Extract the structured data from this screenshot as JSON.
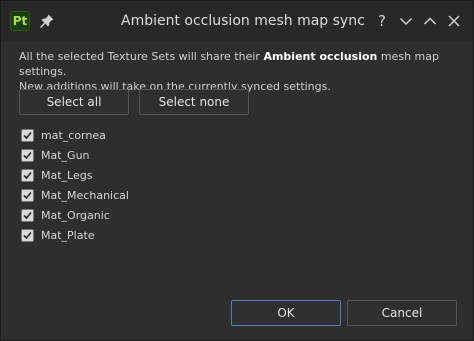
{
  "window": {
    "title": "Ambient occlusion mesh map sync",
    "logo_text": "Pt"
  },
  "titlebar_buttons": {
    "help": "?",
    "minimize": "chevron-down",
    "maximize": "chevron-up",
    "close": "close"
  },
  "description": {
    "line1_prefix": "All the selected Texture Sets will share their ",
    "line1_bold": "Ambient occlusion",
    "line1_suffix": " mesh map settings.",
    "line2": "New additions will take on the currently synced settings."
  },
  "actions": {
    "select_all": "Select all",
    "select_none": "Select none"
  },
  "texture_sets": [
    {
      "label": "mat_cornea",
      "checked": true
    },
    {
      "label": "Mat_Gun",
      "checked": true
    },
    {
      "label": "Mat_Legs",
      "checked": true
    },
    {
      "label": "Mat_Mechanical",
      "checked": true
    },
    {
      "label": "Mat_Organic",
      "checked": true
    },
    {
      "label": "Mat_Plate",
      "checked": true
    }
  ],
  "footer": {
    "ok": "OK",
    "cancel": "Cancel"
  },
  "colors": {
    "accent": "#5a7fb8",
    "logo_green": "#a7e24b"
  }
}
